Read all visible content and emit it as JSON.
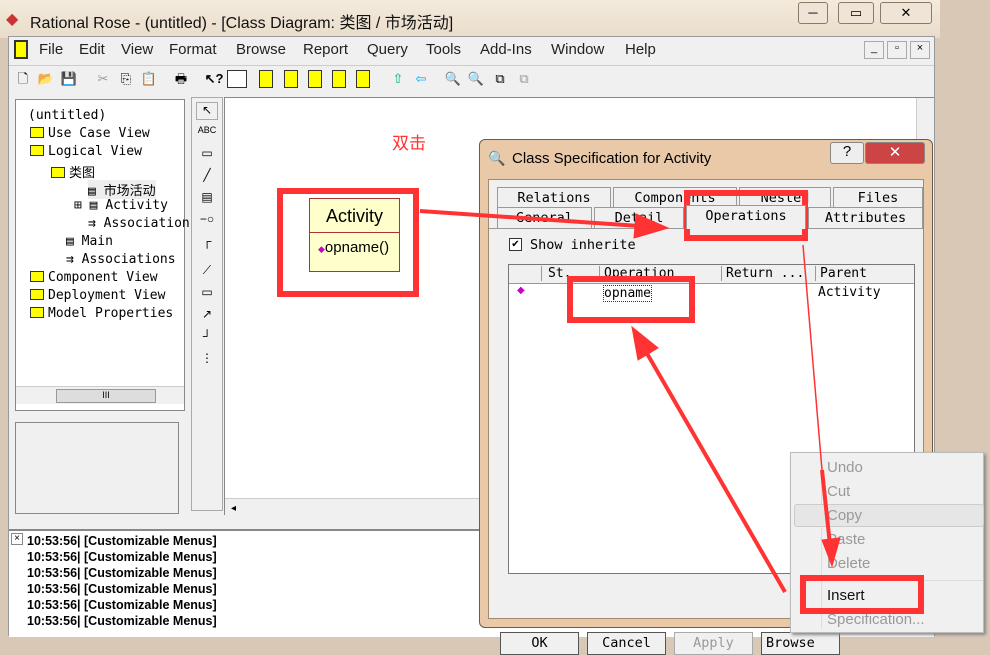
{
  "app": {
    "title": "Rational Rose - (untitled) - [Class Diagram: 类图 / 市场活动]"
  },
  "menu": [
    "File",
    "Edit",
    "View",
    "Format",
    "Browse",
    "Report",
    "Query",
    "Tools",
    "Add-Ins",
    "Window",
    "Help"
  ],
  "toolbar_icons": [
    "new-icon",
    "open-icon",
    "save-icon",
    "cut-icon",
    "copy-icon",
    "paste-icon",
    "print-icon",
    "context-help-icon",
    "view-doc-icon",
    "class-diagram-icon",
    "interaction-diagram-icon",
    "component-diagram-icon",
    "statechart-icon",
    "deployment-icon",
    "browse-parent-icon",
    "previous-diagram-icon",
    "zoom-in-icon",
    "zoom-out-icon",
    "fit-window-icon",
    "undo-fit-icon"
  ],
  "browser": {
    "items": [
      "(untitled)",
      "Use Case View",
      "Logical View",
      "类图",
      "市场活动",
      "Activity",
      "Associations",
      "Main",
      "Associations",
      "Component View",
      "Deployment View",
      "Model Properties"
    ]
  },
  "diagram": {
    "annotation": "双击",
    "class_name": "Activity",
    "operation": "opname()"
  },
  "dialog": {
    "title": "Class Specification for Activity",
    "tabs_row1": [
      "Relations",
      "Components",
      "Nested",
      "Files"
    ],
    "tabs_row2": [
      "General",
      "Detail",
      "Operations",
      "Attributes"
    ],
    "active_tab": "Operations",
    "show_inherited": {
      "label": "Show inherite",
      "checked": true
    },
    "columns": [
      "St.",
      "Operation",
      "Return ...",
      "Parent"
    ],
    "rows": [
      {
        "operation": "opname",
        "parent": "Activity"
      }
    ],
    "buttons": {
      "ok": "OK",
      "cancel": "Cancel",
      "apply": "Apply",
      "browse": "Browse"
    }
  },
  "context_menu": {
    "items": [
      {
        "label": "Undo",
        "enabled": false
      },
      {
        "label": "Cut",
        "enabled": false
      },
      {
        "label": "Copy",
        "enabled": false
      },
      {
        "label": "Paste",
        "enabled": false
      },
      {
        "label": "Delete",
        "enabled": false
      },
      {
        "label": "Insert",
        "enabled": true
      },
      {
        "label": "Specification...",
        "enabled": false
      }
    ]
  },
  "log": {
    "lines": [
      "10:53:56|  [Customizable Menus]",
      "10:53:56|  [Customizable Menus]",
      "10:53:56|  [Customizable Menus]",
      "10:53:56|  [Customizable Menus]",
      "10:53:56|  [Customizable Menus]",
      "10:53:56|  [Customizable Menus]"
    ]
  },
  "annotation_color": "#ff3333"
}
